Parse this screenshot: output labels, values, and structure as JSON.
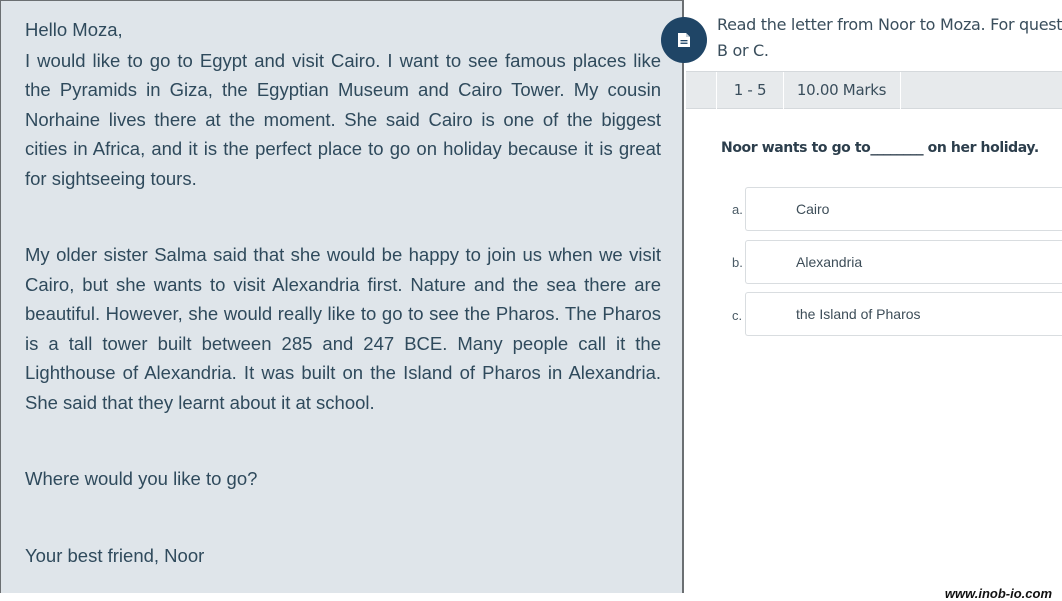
{
  "letter": {
    "greeting": "Hello Moza,",
    "paragraph1": "I would like to go to Egypt and visit Cairo. I want to see famous places like the Pyramids in Giza, the Egyptian Museum and Cairo Tower. My cousin Norhaine lives there at the moment. She said Cairo is one of the biggest cities in Africa, and it is the perfect place to go on holiday because it is great for sightseeing tours.",
    "paragraph2": "My older sister Salma said that she would be happy to join us when we visit Cairo, but she wants to visit Alexandria first. Nature and the sea there are beautiful. However, she would really like to go to see the Pharos. The Pharos is a tall tower built between 285 and 247 BCE. Many people call it the Lighthouse of Alexandria. It was built on the Island of Pharos in Alexandria. She said that they learnt about it at school.",
    "question_line": "Where would you like to go?",
    "signoff": "Your best friend, Noor"
  },
  "instructions": {
    "line1": "Read the letter from Noor to Moza. For questions",
    "line2": "B or C."
  },
  "question_bar": {
    "range": "1 - 5",
    "marks": "10.00 Marks"
  },
  "question": {
    "text": "Noor wants to go to________ on her holiday.",
    "options": [
      {
        "letter": "a.",
        "text": "Cairo"
      },
      {
        "letter": "b.",
        "text": "Alexandria"
      },
      {
        "letter": "c.",
        "text": "the Island of Pharos"
      }
    ]
  },
  "watermark": "www.inob-io.com",
  "icons": {
    "document_button": "document-icon"
  },
  "colors": {
    "left_pane_bg": "#dfe5ea",
    "letter_text": "#2f4a5c",
    "doc_button_bg": "#1f4566"
  }
}
